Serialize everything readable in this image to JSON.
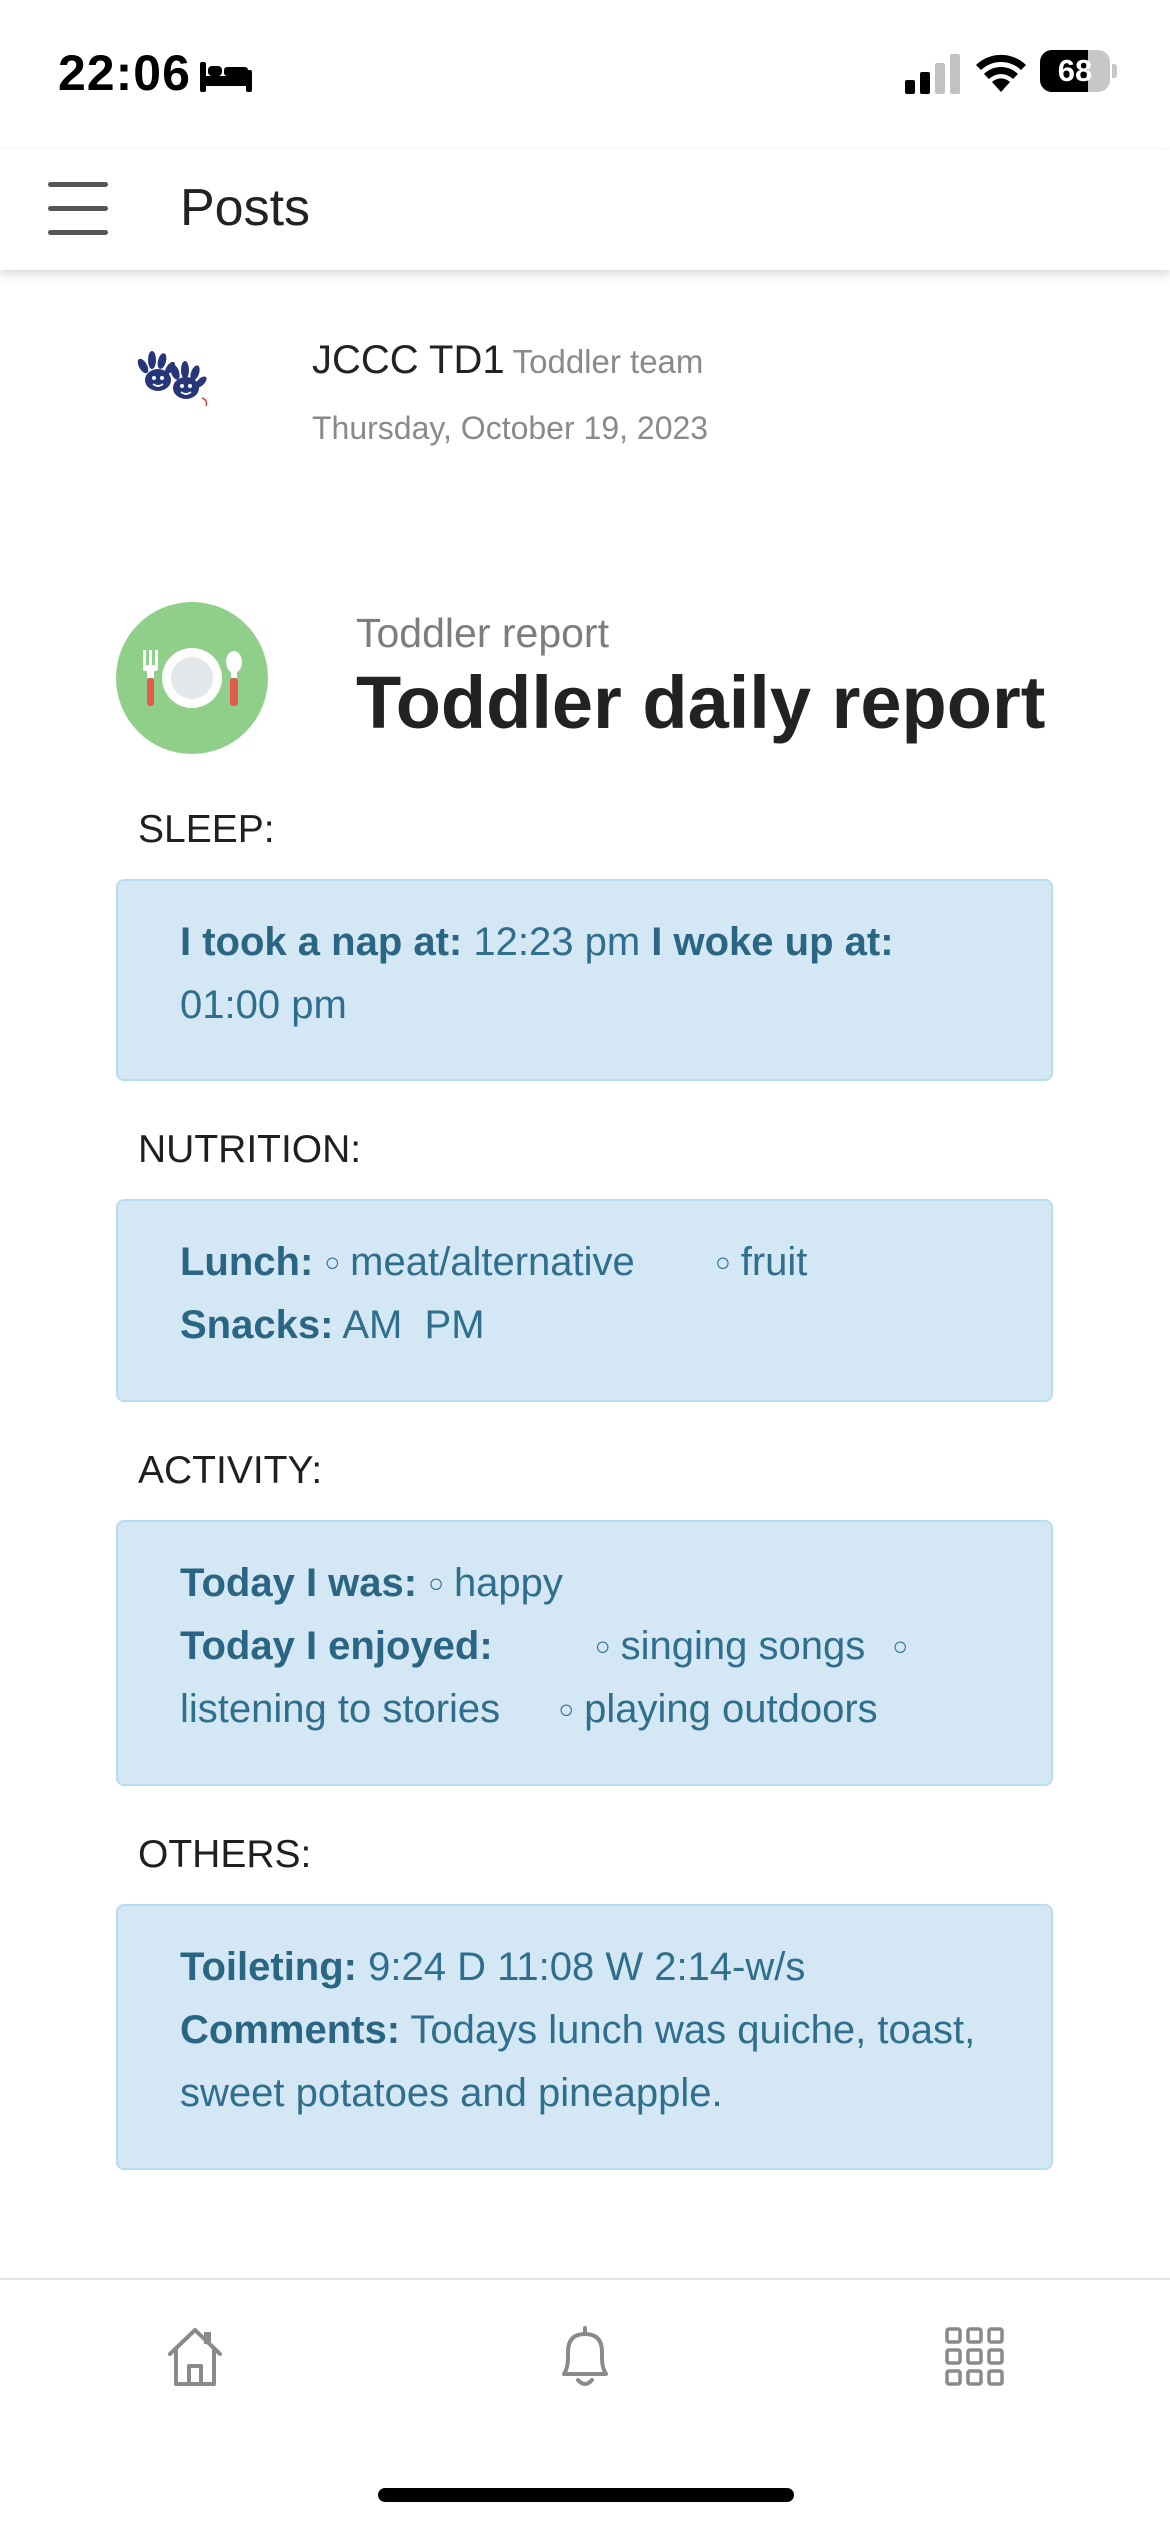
{
  "status_bar": {
    "time": "22:06",
    "battery": "68",
    "battery_level_percent": 68,
    "icons": [
      "bed-icon",
      "cellular-signal-icon",
      "wifi-icon",
      "battery-icon"
    ]
  },
  "header": {
    "title": "Posts",
    "menu_icon": "hamburger-menu-icon"
  },
  "post": {
    "author": "JCCC TD1",
    "team": "Toddler team",
    "date": "Thursday, October 19, 2023",
    "avatar_icon": "handprint-logo-icon"
  },
  "report": {
    "subtitle": "Toddler report",
    "title": "Toddler daily report",
    "icon": "plate-fork-spoon-icon",
    "icon_color": "#8fcf8a"
  },
  "sections": {
    "sleep": {
      "label": "SLEEP:",
      "nap_label": "I took a nap at:",
      "nap_time": "12:23 pm",
      "woke_label": "I woke up at:",
      "woke_time": "01:00 pm"
    },
    "nutrition": {
      "label": "NUTRITION:",
      "lunch_label": "Lunch:",
      "lunch_items": [
        "meat/alternative",
        "fruit"
      ],
      "snacks_label": "Snacks:",
      "snacks_value": "AM  PM"
    },
    "activity": {
      "label": "ACTIVITY:",
      "was_label": "Today I was:",
      "was_value": "happy",
      "enjoyed_label": "Today I enjoyed:",
      "enjoyed_items": [
        "singing songs",
        "listening to stories",
        "playing outdoors"
      ]
    },
    "others": {
      "label": "OTHERS:",
      "toileting_label": "Toileting:",
      "toileting_value": "9:24 D 11:08 W 2:14-w/s",
      "comments_label": "Comments:",
      "comments_value": "Todays lunch was quiche, toast, sweet potatoes and pineapple."
    }
  },
  "bottom_nav": {
    "items": [
      "home-icon",
      "notifications-bell-icon",
      "apps-grid-icon"
    ]
  },
  "colors": {
    "card_background": "#d3e8f4",
    "card_text": "#2f6e8c",
    "report_icon_green": "#8fcf8a"
  }
}
